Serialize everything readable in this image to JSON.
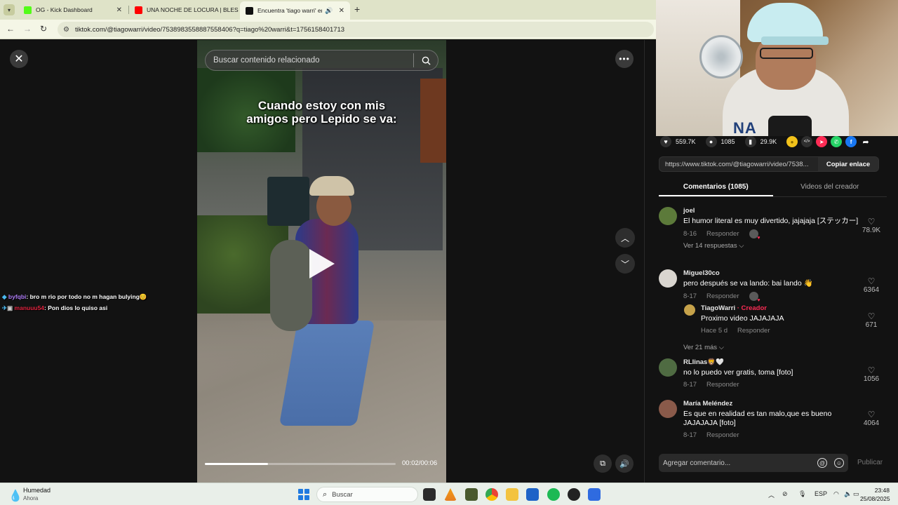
{
  "browser": {
    "tabs": [
      {
        "title": "OG - Kick Dashboard",
        "favicon_color": "#53fc18"
      },
      {
        "title": "UNA NOCHE DE LOCURA | BLES",
        "favicon_color": "#ff0000"
      },
      {
        "title": "Encuentra 'tiago warri' en T",
        "favicon_color": "#111111"
      }
    ],
    "url": "tiktok.com/@tiagowarri/video/7538983558887558406?q=tiago%20warri&t=1756158401713"
  },
  "video": {
    "search_placeholder": "Buscar contenido relacionado",
    "caption_line1": "Cuando estoy con mis",
    "caption_line2": "amigos pero Lepido se va:",
    "time": "00:02/00:06",
    "progress_fraction": 0.33
  },
  "stream_chat": [
    {
      "user": "byfqbi",
      "message": ": bro m rio por todo no m hagan bulying😊"
    },
    {
      "user": "manuuu54",
      "message": ": Pon dios lo quiso asi"
    }
  ],
  "panel": {
    "stats": {
      "likes": "559.7K",
      "comments": "1085",
      "saves": "29.9K"
    },
    "share_icons": [
      {
        "name": "coin-icon",
        "color": "#f2c21b",
        "glyph": "●"
      },
      {
        "name": "embed-icon",
        "color": "#2f2f2f",
        "glyph": "</>"
      },
      {
        "name": "send-icon",
        "color": "#fe2c55",
        "glyph": "➤"
      },
      {
        "name": "whatsapp-icon",
        "color": "#25d366",
        "glyph": "✆"
      },
      {
        "name": "facebook-icon",
        "color": "#1877f2",
        "glyph": "f"
      },
      {
        "name": "forward-icon",
        "color": "#121212",
        "glyph": "➦"
      }
    ],
    "link_url": "https://www.tiktok.com/@tiagowarri/video/7538...",
    "copy_link_label": "Copiar enlace",
    "tabs": [
      "Comentarios (1085)",
      "Videos del creador"
    ],
    "comments": [
      {
        "user": "joel",
        "text": "El humor literal es muy divertido, jajajaja [ステッカー]",
        "date": "8-16",
        "reply": "Responder",
        "likes": "78.9K",
        "more": "Ver 14 respuestas ⌵",
        "avatar_color": "#5c7a3a"
      },
      {
        "user": "Miguel30co",
        "text": "pero después se va lando: bai lando 👋",
        "date": "8-17",
        "reply": "Responder",
        "likes": "6364",
        "more": "",
        "avatar_color": "#d9d5cf"
      },
      {
        "user": "TiagoWarri",
        "creator_label": " · Creador",
        "text": "Proximo video JAJAJAJA",
        "date": "Hace 5 d",
        "reply": "Responder",
        "likes": "671",
        "more": "Ver 21 más ⌵",
        "avatar_color": "#c6a24a"
      },
      {
        "user": "RLlinas🦁🤍",
        "text": "no lo puedo ver gratis, toma [foto]",
        "date": "8-17",
        "reply": "Responder",
        "likes": "1056",
        "more": "",
        "avatar_color": "#4f6b42"
      },
      {
        "user": "María Meléndez",
        "text": "Es que en realidad es tan malo,que es bueno JAJAJAJA [foto]",
        "date": "8-17",
        "reply": "Responder",
        "likes": "4064",
        "more": "",
        "avatar_color": "#8a5a4a"
      }
    ],
    "comment_placeholder": "Agregar comentario...",
    "post_label": "Publicar"
  },
  "webcam": {
    "shirt_text": "NA"
  },
  "taskbar": {
    "weather_title": "Humedad",
    "weather_sub": "Ahora",
    "search_label": "Buscar",
    "lang": "ESP",
    "time": "23:48",
    "date": "25/08/2025"
  }
}
